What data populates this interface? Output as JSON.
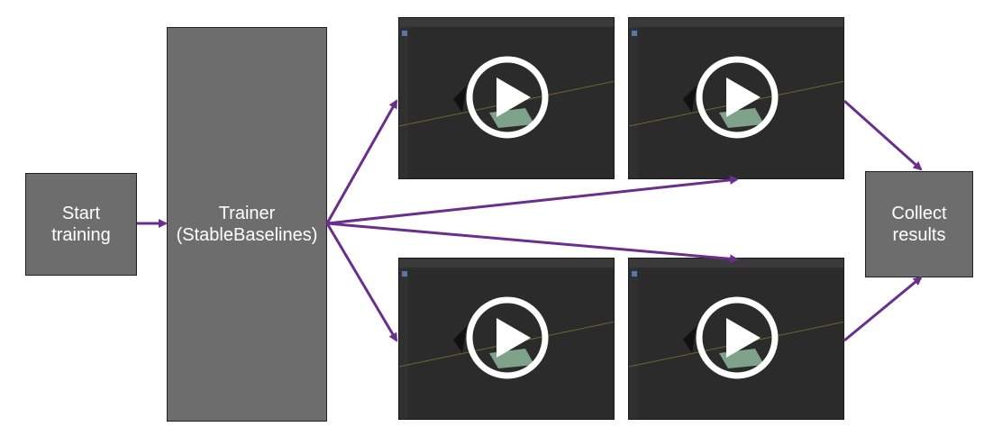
{
  "nodes": {
    "start": {
      "label": "Start\ntraining"
    },
    "trainer": {
      "label": "Trainer\n(StableBaselines)"
    },
    "collect": {
      "label": "Collect\nresults"
    }
  },
  "videos": [
    {
      "name": "video-thumbnail-top-left"
    },
    {
      "name": "video-thumbnail-top-right"
    },
    {
      "name": "video-thumbnail-bottom-left"
    },
    {
      "name": "video-thumbnail-bottom-right"
    }
  ],
  "icons": {
    "play": "play-icon",
    "viewport": "blender-viewport-icon"
  },
  "colors": {
    "box_fill": "#6d6d6d",
    "box_text": "#ffffff",
    "arrow": "#6a2e8c",
    "thumb_bg": "#2b2b2b",
    "play_ring": "#ffffff",
    "plane": "#7fa38a"
  }
}
